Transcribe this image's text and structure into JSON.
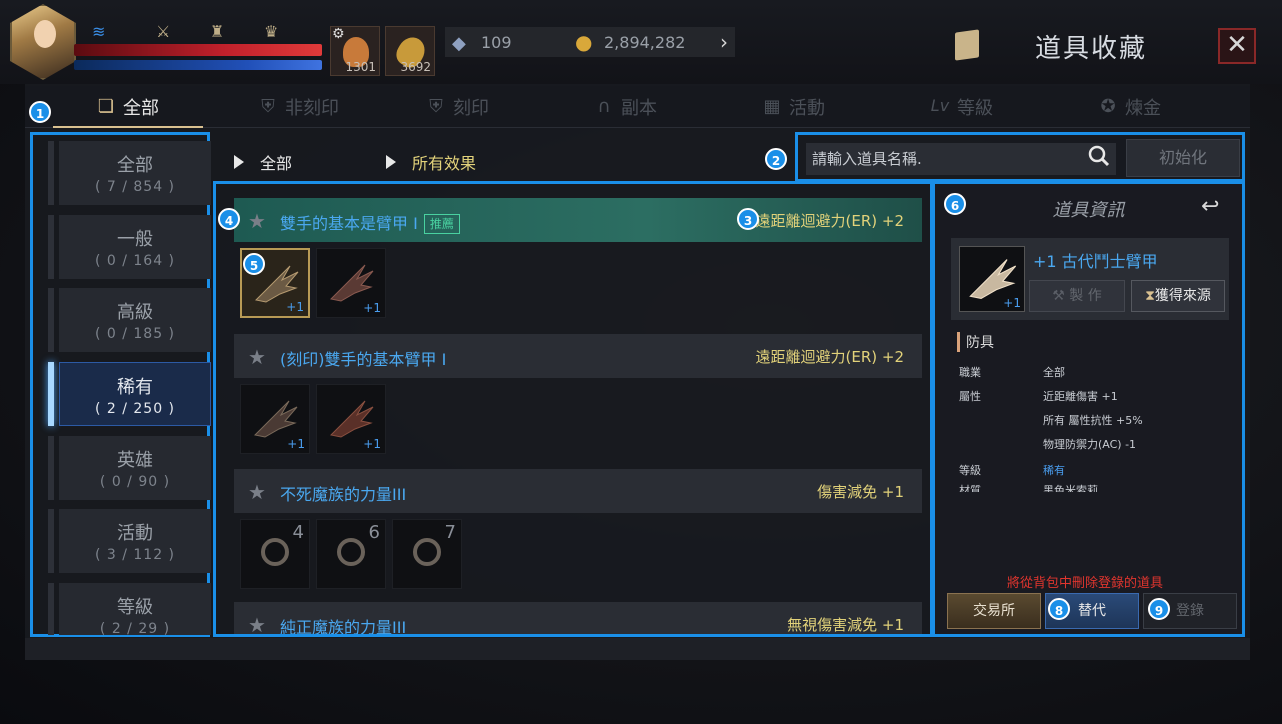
{
  "topbar": {
    "potions": [
      {
        "count": "1301"
      },
      {
        "count": "3692"
      }
    ],
    "crystal_count": "109",
    "gold": "2,894,282",
    "title": "道具收藏",
    "close_label": "✕"
  },
  "tabs": [
    {
      "label": "全部"
    },
    {
      "label": "非刻印"
    },
    {
      "label": "刻印"
    },
    {
      "label": "副本"
    },
    {
      "label": "活動"
    },
    {
      "label": "等級"
    },
    {
      "label": "煉金"
    }
  ],
  "categories": [
    {
      "name": "全部",
      "count": "( 7 / 854 )"
    },
    {
      "name": "一般",
      "count": "( 0 / 164 )"
    },
    {
      "name": "高級",
      "count": "( 0 / 185 )"
    },
    {
      "name": "稀有",
      "count": "( 2 / 250 )"
    },
    {
      "name": "英雄",
      "count": "( 0 / 90 )"
    },
    {
      "name": "活動",
      "count": "( 3 / 112 )"
    },
    {
      "name": "等級",
      "count": "( 2 / 29 )"
    }
  ],
  "filters": {
    "category": "全部",
    "effect": "所有效果"
  },
  "search": {
    "placeholder": "請輸入道具名稱.",
    "reset_label": "初始化"
  },
  "items": [
    {
      "title": "雙手的基本是臂甲 I",
      "badge": "推薦",
      "effect": "遠距離迴避力(ER) +2"
    },
    {
      "title": "(刻印)雙手的基本臂甲 I",
      "effect": "遠距離迴避力(ER) +2"
    },
    {
      "title": "不死魔族的力量III",
      "effect": "傷害減免 +1"
    },
    {
      "title": "純正魔族的力量III",
      "effect": "無視傷害減免 +1"
    }
  ],
  "slots": {
    "lvl": "+1",
    "ring_counts": [
      "4",
      "6",
      "7"
    ]
  },
  "info": {
    "title": "道具資訊",
    "item_name": "+1 古代鬥士臂甲",
    "item_lvl": "+1",
    "craft_label": "製 作",
    "source_label": "獲得來源",
    "section": "防具",
    "rows": [
      {
        "key": "職業",
        "value": "全部"
      },
      {
        "key": "屬性",
        "value": "近距離傷害 +1"
      },
      {
        "key": "",
        "value": "所有 屬性抗性 +5%"
      },
      {
        "key": "",
        "value": "物理防禦力(AC) -1"
      },
      {
        "key": "等級",
        "value": "稀有"
      },
      {
        "key": "材質",
        "value": "黑色米索莉"
      }
    ],
    "warning": "將從背包中刪除登錄的道具",
    "btn_exchange": "交易所",
    "btn_replace": "替代",
    "btn_register": "登錄"
  },
  "markers": [
    "1",
    "2",
    "3",
    "4",
    "5",
    "6",
    "8",
    "9"
  ],
  "colors": {
    "accent": "#1a8fe8",
    "gold_text": "#e2d27a",
    "item_blue": "#4aa8f0",
    "warning": "#e0352e"
  }
}
